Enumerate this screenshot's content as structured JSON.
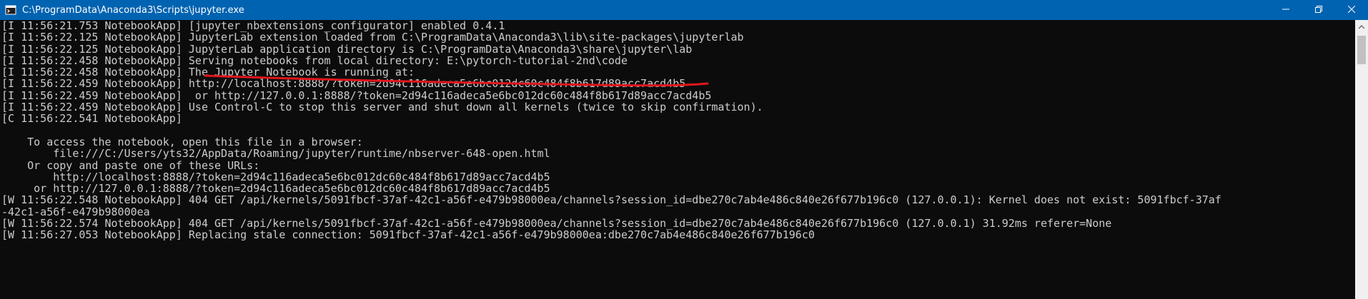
{
  "window": {
    "title": "C:\\ProgramData\\Anaconda3\\Scripts\\jupyter.exe",
    "controls": {
      "minimize_icon": "minimize-icon",
      "maximize_icon": "maximize-icon",
      "close_icon": "close-icon"
    }
  },
  "colors": {
    "titlebar": "#0063b1",
    "console_bg": "#0c0c0c",
    "console_text": "#cccccc",
    "annotation_stroke": "#e0161c"
  },
  "console": {
    "lines": [
      "[I 11:56:21.753 NotebookApp] [jupyter_nbextensions_configurator] enabled 0.4.1",
      "[I 11:56:22.125 NotebookApp] JupyterLab extension loaded from C:\\ProgramData\\Anaconda3\\lib\\site-packages\\jupyterlab",
      "[I 11:56:22.125 NotebookApp] JupyterLab application directory is C:\\ProgramData\\Anaconda3\\share\\jupyter\\lab",
      "[I 11:56:22.458 NotebookApp] Serving notebooks from local directory: E:\\pytorch-tutorial-2nd\\code",
      "[I 11:56:22.458 NotebookApp] The Jupyter Notebook is running at:",
      "[I 11:56:22.459 NotebookApp] http://localhost:8888/?token=2d94c116adeca5e6bc012dc60c484f8b617d89acc7acd4b5",
      "[I 11:56:22.459 NotebookApp]  or http://127.0.0.1:8888/?token=2d94c116adeca5e6bc012dc60c484f8b617d89acc7acd4b5",
      "[I 11:56:22.459 NotebookApp] Use Control-C to stop this server and shut down all kernels (twice to skip confirmation).",
      "[C 11:56:22.541 NotebookApp]",
      "",
      "    To access the notebook, open this file in a browser:",
      "        file:///C:/Users/yts32/AppData/Roaming/jupyter/runtime/nbserver-648-open.html",
      "    Or copy and paste one of these URLs:",
      "        http://localhost:8888/?token=2d94c116adeca5e6bc012dc60c484f8b617d89acc7acd4b5",
      "     or http://127.0.0.1:8888/?token=2d94c116adeca5e6bc012dc60c484f8b617d89acc7acd4b5",
      "[W 11:56:22.548 NotebookApp] 404 GET /api/kernels/5091fbcf-37af-42c1-a56f-e479b98000ea/channels?session_id=dbe270c7ab4e486c840e26f677b196c0 (127.0.0.1): Kernel does not exist: 5091fbcf-37af",
      "-42c1-a56f-e479b98000ea",
      "[W 11:56:22.574 NotebookApp] 404 GET /api/kernels/5091fbcf-37af-42c1-a56f-e479b98000ea/channels?session_id=dbe270c7ab4e486c840e26f677b196c0 (127.0.0.1) 31.92ms referer=None",
      "[W 11:56:27.053 NotebookApp] Replacing stale connection: 5091fbcf-37af-42c1-a56f-e479b98000ea:dbe270c7ab4e486c840e26f677b196c0"
    ]
  }
}
